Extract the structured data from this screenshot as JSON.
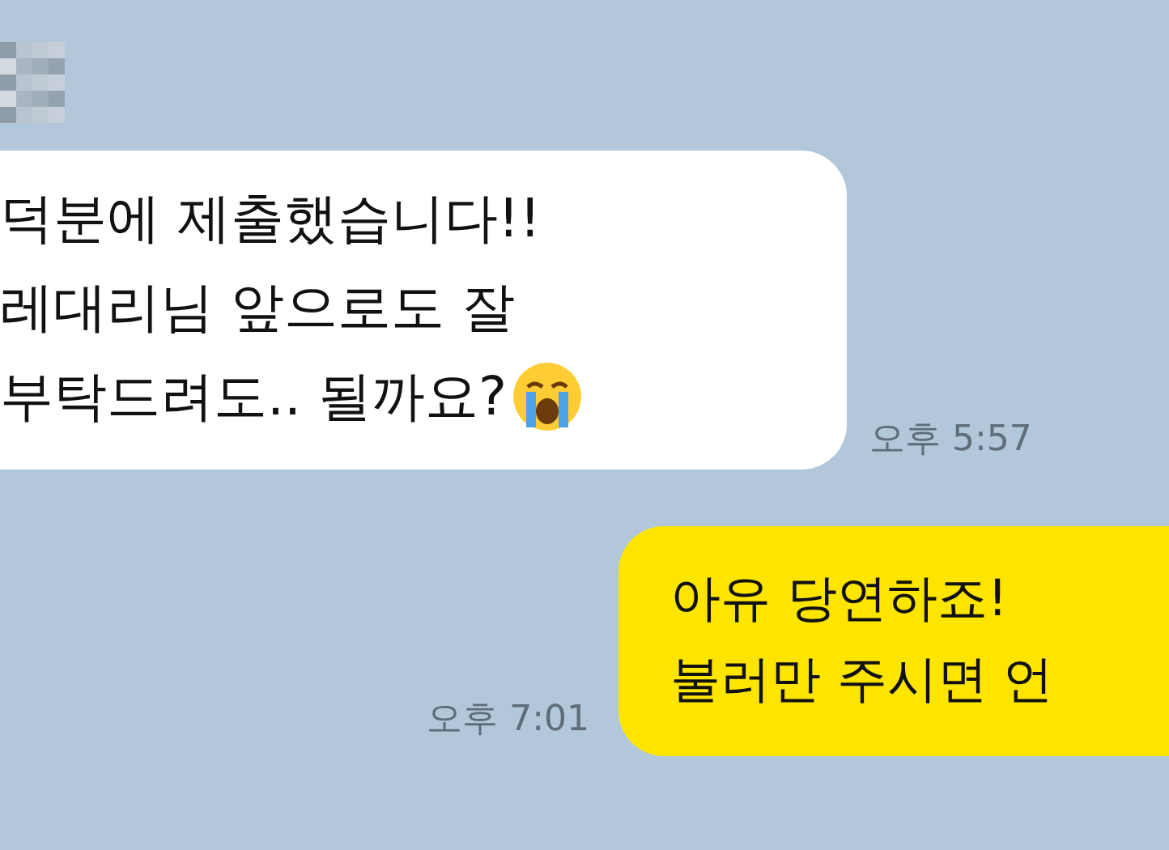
{
  "messages": [
    {
      "kind": "received",
      "sender_hidden": true,
      "lines": [
        "덕분에 제출했습니다!!",
        "레대리님 앞으로도 잘",
        "부탁드려도.. 될까요?"
      ],
      "trailing_icon": true,
      "time": "오후 5:57"
    },
    {
      "kind": "sent",
      "lines": [
        "아유 당연하죠!",
        "불러만 주시면 언"
      ],
      "trailing_icon": false,
      "time": "오후 7:01"
    }
  ]
}
